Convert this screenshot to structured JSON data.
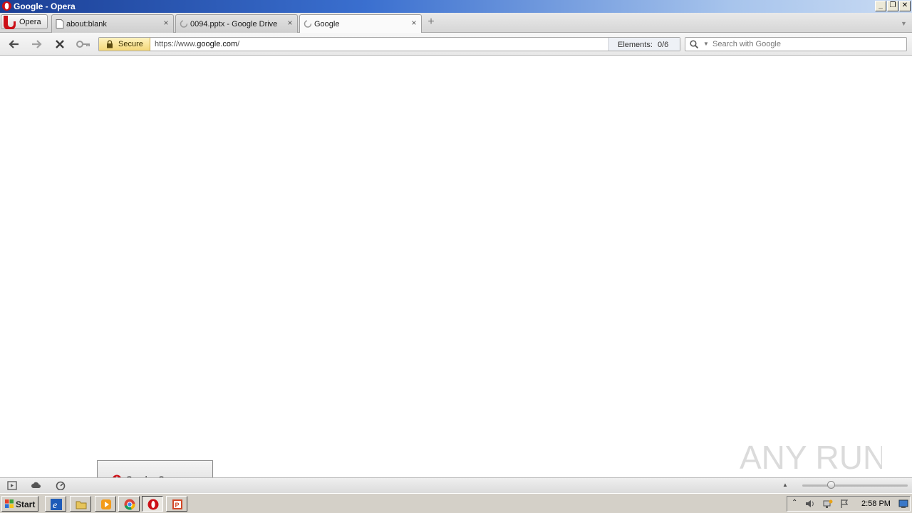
{
  "window": {
    "title": "Google - Opera"
  },
  "menu": {
    "opera_label": "Opera"
  },
  "tabs": [
    {
      "label": "about:blank",
      "active": false
    },
    {
      "label": "0094.pptx - Google Drive",
      "active": false
    },
    {
      "label": "Google",
      "active": true
    }
  ],
  "addressbar": {
    "secure_label": "Secure",
    "url_prefix": "https://www.",
    "url_host": "google.com",
    "url_suffix": "/",
    "elements_label": "Elements:",
    "elements_value": "0/6"
  },
  "search": {
    "placeholder": "Search with Google"
  },
  "taskbar_popup": {
    "label": "Google - Opera"
  },
  "taskbar": {
    "start_label": "Start",
    "apps": [
      "internet-explorer",
      "file-explorer",
      "media-player",
      "chrome",
      "opera",
      "powerpoint"
    ],
    "clock": "2:58 PM"
  },
  "watermark": {
    "text": "ANY RUN"
  },
  "colors": {
    "opera_red": "#cc0f16",
    "titlebar_blue": "#1b3f95",
    "secure_yellow": "#f4d879"
  }
}
